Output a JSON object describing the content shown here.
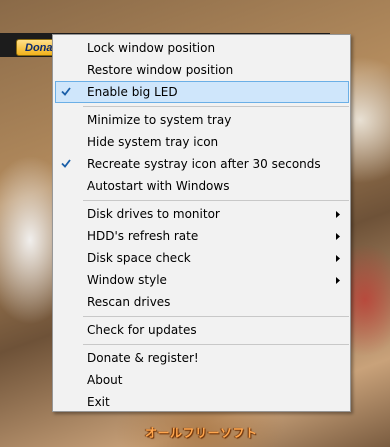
{
  "toolbar": {
    "donate_label": "Donate"
  },
  "menu": {
    "items": [
      {
        "label": "Lock window position",
        "checked": false,
        "submenu": false,
        "highlighted": false
      },
      {
        "label": "Restore window position",
        "checked": false,
        "submenu": false,
        "highlighted": false
      },
      {
        "label": "Enable big LED",
        "checked": true,
        "submenu": false,
        "highlighted": true
      },
      {
        "label": "Minimize to system tray",
        "checked": false,
        "submenu": false,
        "highlighted": false
      },
      {
        "label": "Hide system tray icon",
        "checked": false,
        "submenu": false,
        "highlighted": false
      },
      {
        "label": "Recreate systray icon after 30 seconds",
        "checked": true,
        "submenu": false,
        "highlighted": false
      },
      {
        "label": "Autostart with Windows",
        "checked": false,
        "submenu": false,
        "highlighted": false
      },
      {
        "label": "Disk drives to monitor",
        "checked": false,
        "submenu": true,
        "highlighted": false
      },
      {
        "label": "HDD's refresh rate",
        "checked": false,
        "submenu": true,
        "highlighted": false
      },
      {
        "label": "Disk space check",
        "checked": false,
        "submenu": true,
        "highlighted": false
      },
      {
        "label": "Window style",
        "checked": false,
        "submenu": true,
        "highlighted": false
      },
      {
        "label": "Rescan drives",
        "checked": false,
        "submenu": false,
        "highlighted": false
      },
      {
        "label": "Check for updates",
        "checked": false,
        "submenu": false,
        "highlighted": false
      },
      {
        "label": "Donate & register!",
        "checked": false,
        "submenu": false,
        "highlighted": false
      },
      {
        "label": "About",
        "checked": false,
        "submenu": false,
        "highlighted": false
      },
      {
        "label": "Exit",
        "checked": false,
        "submenu": false,
        "highlighted": false
      }
    ]
  },
  "watermark": {
    "text": "オールフリーソフト"
  },
  "colors": {
    "highlight_bg": "#cfe6fb",
    "highlight_border": "#6bafe6",
    "check_color": "#1a5fa8"
  }
}
